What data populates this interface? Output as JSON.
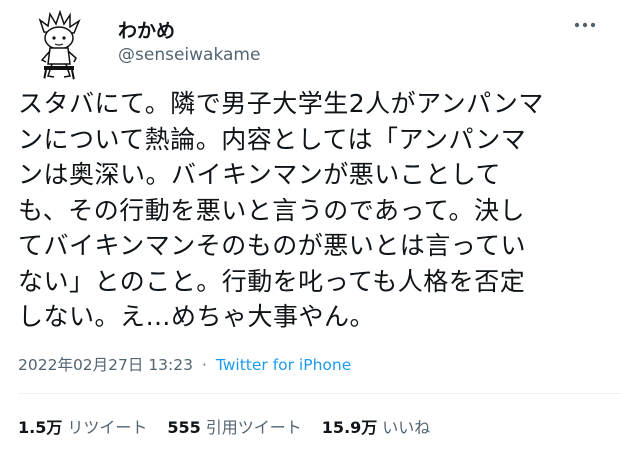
{
  "user": {
    "display_name": "わかめ",
    "handle": "@senseiwakame"
  },
  "tweet": {
    "lines": [
      "スタバにて。隣で男子大学生2人がアンパンマ",
      "ンについて熱論。内容としては「アンパンマ",
      "ンは奥深い。バイキンマンが悪いことして",
      "も、その行動を悪いと言うのであって。決し",
      "てバイキンマンそのものが悪いとは言ってい",
      "ない」とのこと。行動を叱っても人格を否定",
      "しない。え…めちゃ大事やん。"
    ],
    "datetime": "2022年02月27日 13:23",
    "separator": "·",
    "source": "Twitter for iPhone"
  },
  "stats": {
    "retweets": {
      "value": "1.5万",
      "label": "リツイート"
    },
    "quotes": {
      "value": "555",
      "label": "引用ツイート"
    },
    "likes": {
      "value": "15.9万",
      "label": "いいね"
    }
  },
  "icons": {
    "more": "more-horizontal-icon",
    "avatar": "avatar-cartoon"
  },
  "colors": {
    "text": "#0f1419",
    "secondary": "#536471",
    "link": "#1d9bf0"
  }
}
